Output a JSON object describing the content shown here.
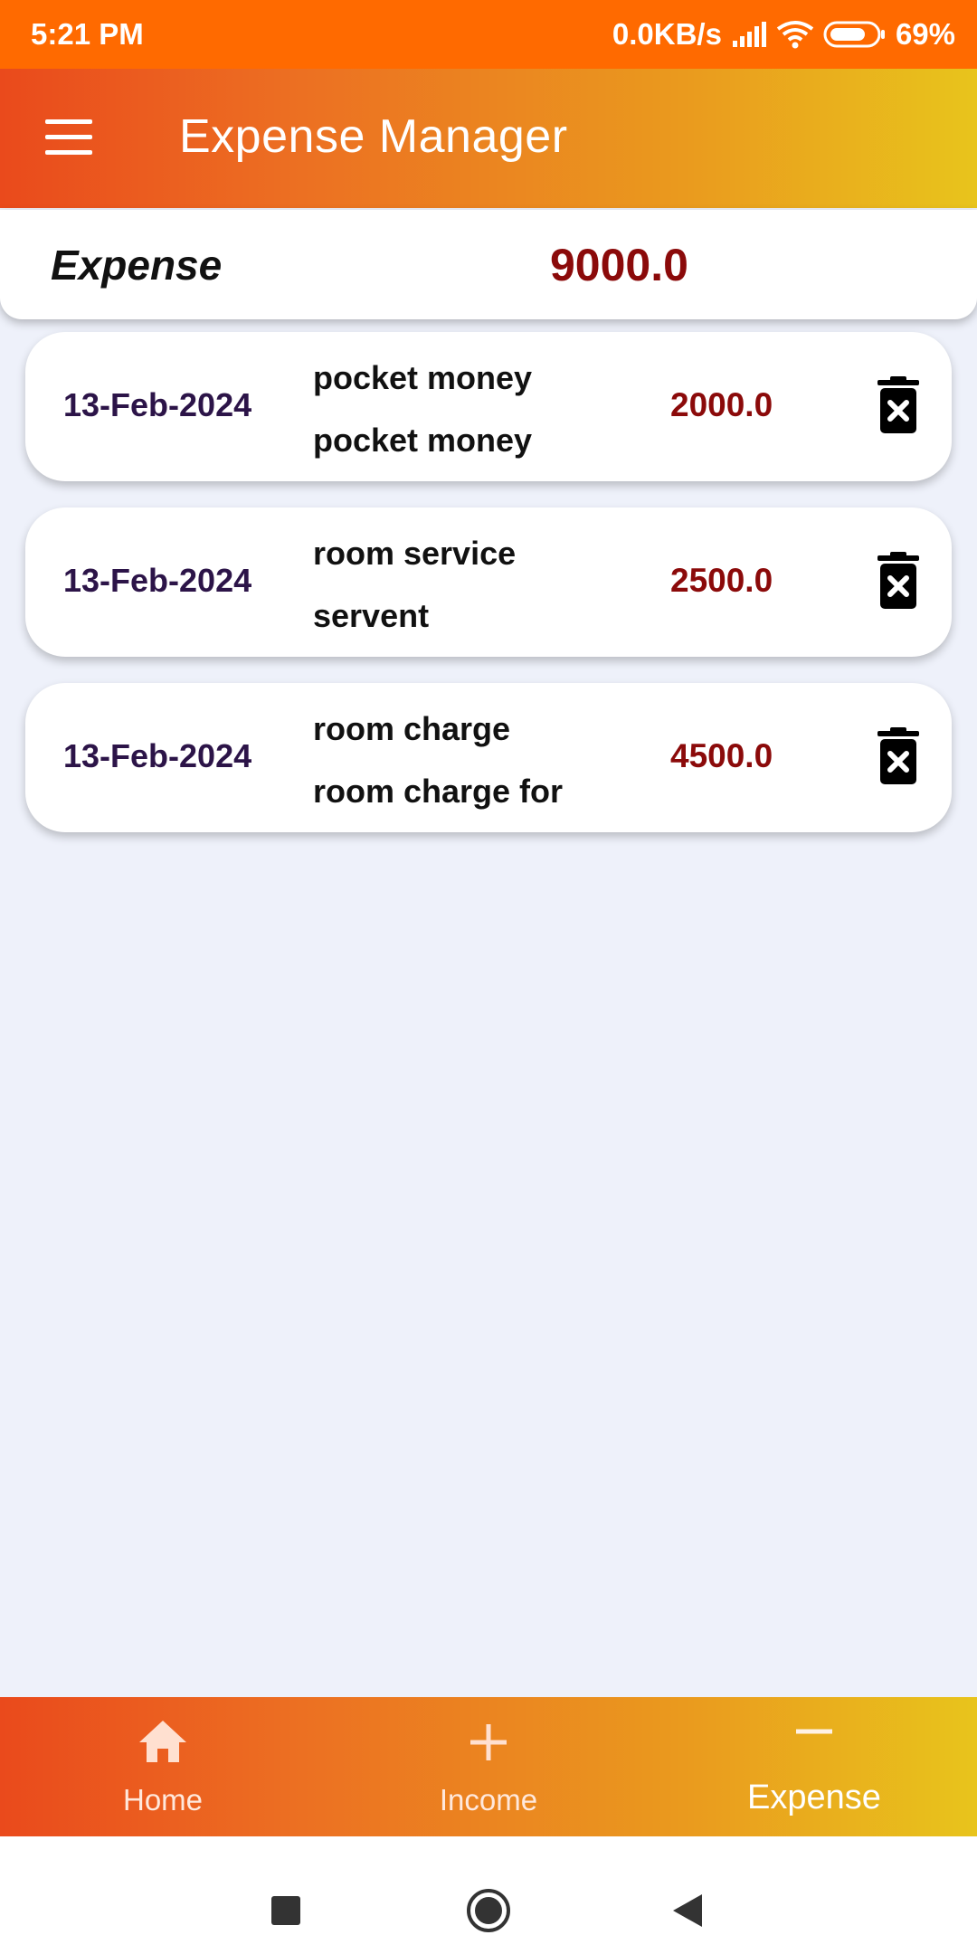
{
  "status_bar": {
    "time": "5:21 PM",
    "network_speed": "0.0KB/s",
    "battery": "69%",
    "icons": [
      "signal-icon",
      "wifi-icon",
      "battery-icon"
    ]
  },
  "app_bar": {
    "title": "Expense Manager",
    "menu_icon": "hamburger-menu-icon"
  },
  "summary": {
    "label": "Expense",
    "total": "9000.0"
  },
  "expenses": [
    {
      "date": "13-Feb-2024",
      "title": "pocket money",
      "description": "pocket money",
      "amount": "2000.0"
    },
    {
      "date": "13-Feb-2024",
      "title": "room service",
      "description": "servent",
      "amount": "2500.0"
    },
    {
      "date": "13-Feb-2024",
      "title": "room charge",
      "description": "room charge for",
      "amount": "4500.0"
    }
  ],
  "bottom_nav": {
    "items": [
      {
        "label": "Home",
        "icon": "home-icon"
      },
      {
        "label": "Income",
        "icon": "plus-icon"
      },
      {
        "label": "Expense",
        "icon": "minus-icon"
      }
    ],
    "active": "Expense"
  },
  "system_nav": [
    "recents-button",
    "home-button",
    "back-button"
  ],
  "colors": {
    "status_bar": "#ff6a00",
    "gradient_start": "#ea4a1c",
    "gradient_end": "#e8c41c",
    "amount": "#8b0a0a",
    "date": "#2c1448",
    "background": "#eef1fa"
  }
}
